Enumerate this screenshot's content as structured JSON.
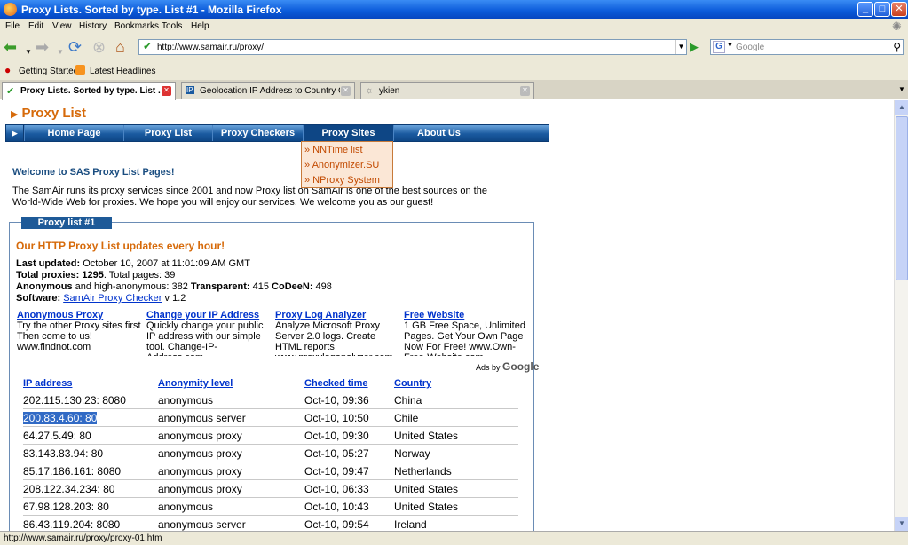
{
  "window": {
    "title": "Proxy Lists. Sorted by type. List #1 - Mozilla Firefox",
    "min": "_",
    "max": "□",
    "close": "✕"
  },
  "menu": [
    "File",
    "Edit",
    "View",
    "History",
    "Bookmarks",
    "Tools",
    "Help"
  ],
  "toolbar": {
    "url": "http://www.samair.ru/proxy/",
    "search_placeholder": "Google",
    "go": "▶",
    "search_engine": "G",
    "url_dropdown": "▼"
  },
  "bookmarks": [
    "Getting Started",
    "Latest Headlines"
  ],
  "tabs": [
    {
      "label": "Proxy Lists. Sorted by type. List ...",
      "icon": "✔",
      "active": true
    },
    {
      "label": "Geolocation IP Address to Country Cit...",
      "icon": "IP"
    },
    {
      "label": "ykien",
      "icon": "☼"
    }
  ],
  "page": {
    "site_title": "Proxy List",
    "nav": [
      "Home Page",
      "Proxy List",
      "Proxy Checkers",
      "Proxy Sites",
      "About Us"
    ],
    "dropdown": [
      "» NNTime list",
      "» Anonymizer.SU",
      "» NProxy System"
    ],
    "welcome": "Welcome to SAS Proxy List Pages!",
    "intro": "The SamAir runs its proxy services since 2001 and now Proxy list on SamAir is one of the best sources on the World-Wide Web for proxies. We hope you will enjoy our services. We welcome you as our guest!",
    "panel_label": "Proxy list #1",
    "updates": "Our HTTP Proxy List updates every hour!",
    "last_updated_label": "Last updated:",
    "last_updated": "October 10, 2007 at 11:01:09 AM GMT",
    "total_label": "Total proxies:",
    "total": "1295",
    "total_pages": ". Total pages: 39",
    "anonymous_label": "Anonymous",
    "anonymous_text": "and high-anonymous: 382",
    "transparent_label": "Transparent:",
    "transparent": "415",
    "codeen_label": "CoDeeN:",
    "codeen": "498",
    "software_label": "Software:",
    "software_link": "SamAir Proxy Checker",
    "software_version": "v 1.2",
    "ads": [
      {
        "title": "Anonymous Proxy",
        "text": "Try the other Proxy sites first Then come to us! www.findnot.com"
      },
      {
        "title": "Change your IP Address",
        "text": "Quickly change your public IP address with our simple tool. Change-IP-Address.com"
      },
      {
        "title": "Proxy Log Analyzer",
        "text": "Analyze Microsoft Proxy Server 2.0 logs. Create HTML reports www.proxyloganalyzer.com"
      },
      {
        "title": "Free Website",
        "text": "1 GB Free Space, Unlimited Pages. Get Your Own Page Now For Free! www.Own-Free-Website.com"
      }
    ],
    "ads_by": "Ads by",
    "ads_google": "Google",
    "columns": [
      "IP address",
      "Anonymity level",
      "Checked time",
      "Country"
    ],
    "rows": [
      [
        "202.115.130.23: 8080",
        "anonymous",
        "Oct-10, 09:36",
        "China"
      ],
      [
        "200.83.4.60: 80",
        "anonymous server",
        "Oct-10, 10:50",
        "Chile"
      ],
      [
        "64.27.5.49: 80",
        "anonymous proxy",
        "Oct-10, 09:30",
        "United States"
      ],
      [
        "83.143.83.94: 80",
        "anonymous proxy",
        "Oct-10, 05:27",
        "Norway"
      ],
      [
        "85.17.186.161: 8080",
        "anonymous proxy",
        "Oct-10, 09:47",
        "Netherlands"
      ],
      [
        "208.122.34.234: 80",
        "anonymous proxy",
        "Oct-10, 06:33",
        "United States"
      ],
      [
        "67.98.128.203: 80",
        "anonymous",
        "Oct-10, 10:43",
        "United States"
      ],
      [
        "86.43.119.204: 8080",
        "anonymous server",
        "Oct-10, 09:54",
        "Ireland"
      ]
    ]
  },
  "status": "http://www.samair.ru/proxy/proxy-01.htm"
}
